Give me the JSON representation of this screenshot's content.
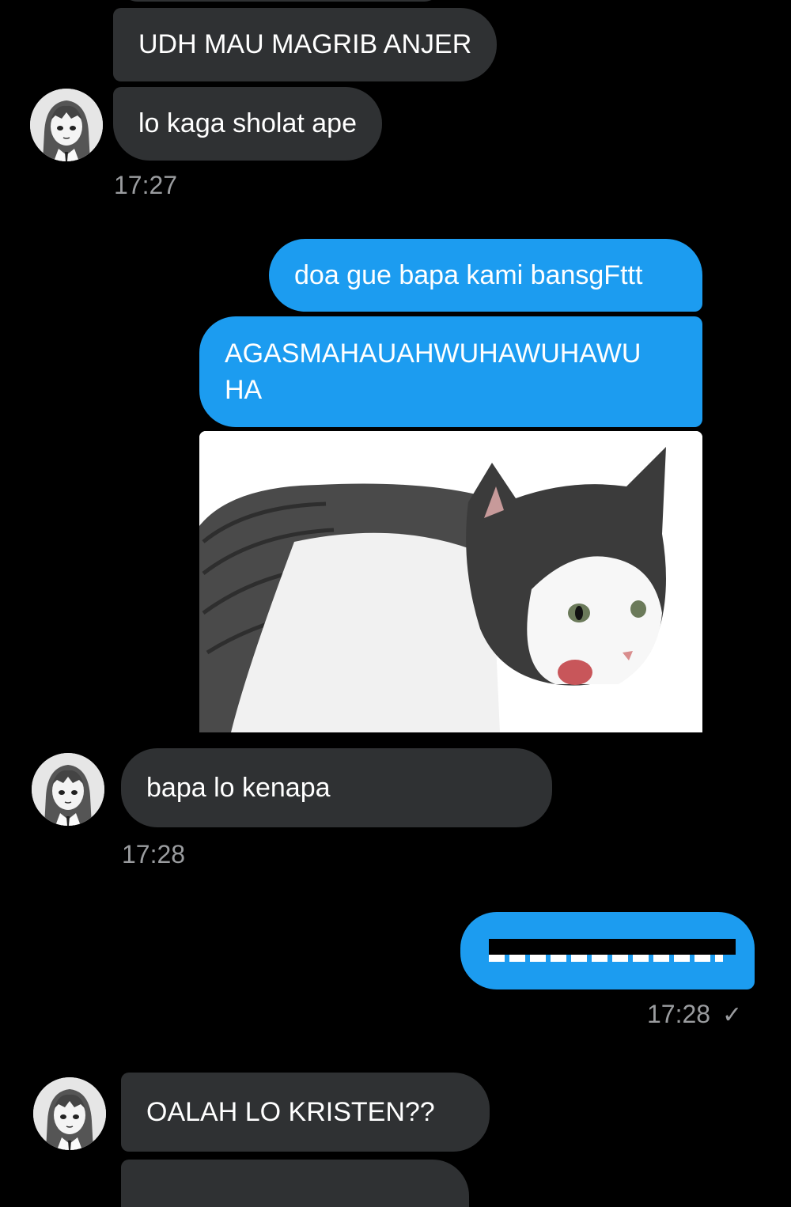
{
  "messages": {
    "m1": "UDH MAU MAGRIB ANJER",
    "m2": "lo kaga sholat ape",
    "t1": "17:27",
    "m3": "doa gue bapa kami bansgFttt",
    "m4_line1": "AGASMAHAUAHWUHAWUHAWU",
    "m4_line2": "HA",
    "m5": "bapa lo kenapa",
    "t2": "17:28",
    "t3": "17:28",
    "t3_status": "✓",
    "m7": "OALAH LO KRISTEN??"
  },
  "colors": {
    "incoming_bubble": "#2f3133",
    "outgoing_bubble": "#1c9cf0",
    "background": "#000000",
    "timestamp": "#9a9c9f"
  },
  "icons": {
    "avatar": "anime-girl-avatar",
    "image": "cat-meme-photo",
    "redaction": "black-redaction-bar",
    "read_receipt": "check-icon"
  }
}
